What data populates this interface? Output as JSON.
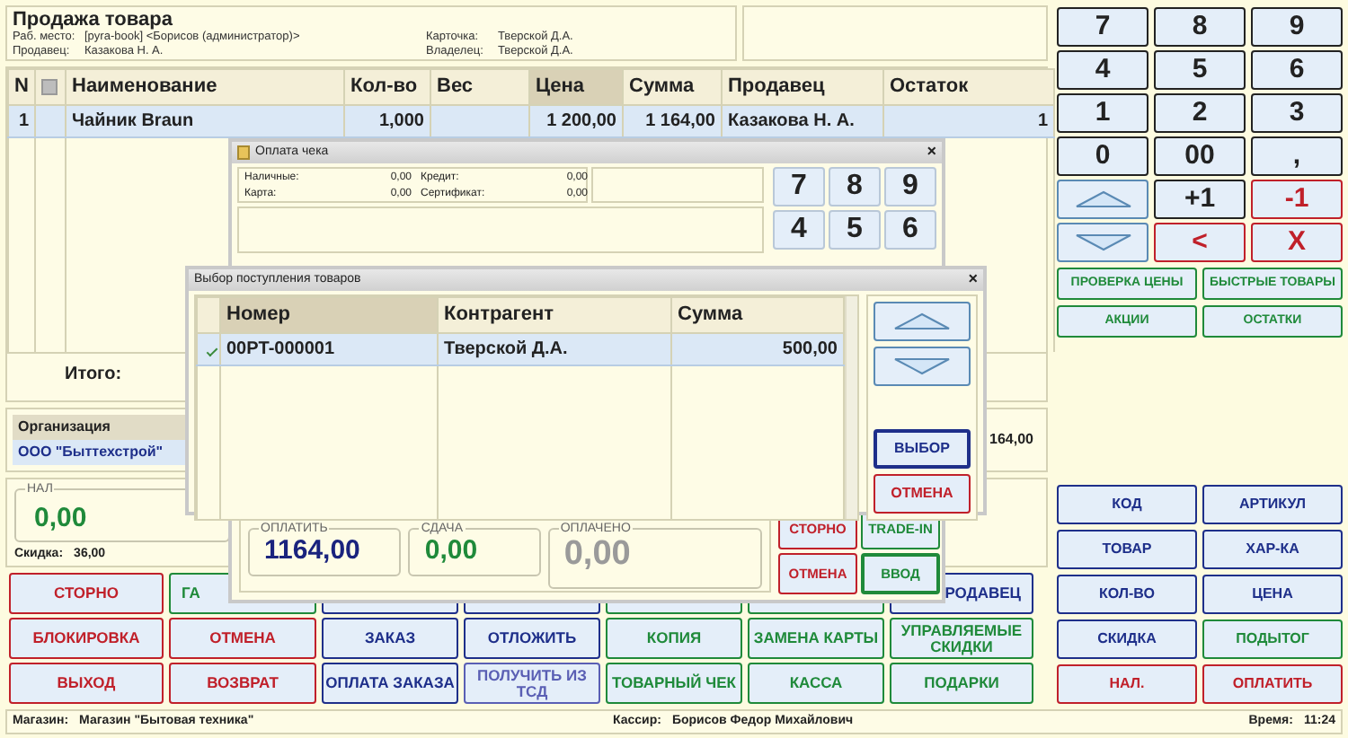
{
  "header": {
    "title": "Продажа товара",
    "fields": [
      {
        "label": "Раб. место:",
        "value": "[pyra-book] <Борисов (администратор)>"
      },
      {
        "label": "Карточка:",
        "value": "Тверской Д.А."
      },
      {
        "label": "Продавец:",
        "value": "Казакова Н. А."
      },
      {
        "label": "Владелец:",
        "value": "Тверской Д.А."
      }
    ]
  },
  "cart": {
    "columns": [
      {
        "label": "N",
        "sorted": false
      },
      {
        "label": "Наименование",
        "sorted": false
      },
      {
        "label": "Кол-во",
        "sorted": false
      },
      {
        "label": "Вес",
        "sorted": false
      },
      {
        "label": "Цена",
        "sorted": true
      },
      {
        "label": "Сумма",
        "sorted": false
      },
      {
        "label": "Продавец",
        "sorted": false
      },
      {
        "label": "Остаток",
        "sorted": false
      }
    ],
    "rows": [
      {
        "n": "1",
        "name": "Чайник Braun",
        "qty": "1,000",
        "price": "1 200,00",
        "sum": "1 164,00",
        "seller": "Казакова Н. А.",
        "stock": "1",
        "selected": true
      }
    ],
    "total_label": "Итого:"
  },
  "organization": {
    "header": "Организация",
    "value": "ООО \"Быттехстрой\"",
    "total": "164,00"
  },
  "cash": {
    "legend": "НАЛ",
    "value": "0,00"
  },
  "discount": {
    "label": "Скидка:",
    "value": "36,00"
  },
  "buttons": [
    [
      {
        "label": "СТОРНО",
        "color": "#c0202a"
      },
      {
        "label": "ГА",
        "color": "#1f8a3a"
      },
      {
        "color": "#1e2f8a"
      },
      {
        "color": "#1e2f8a"
      },
      {
        "color": "#1f8a3a"
      },
      {
        "color": "#1f8a3a"
      },
      {
        "label": "РОДАВЕЦ",
        "color": "#1e2f8a"
      }
    ],
    [
      {
        "label": "БЛОКИРОВКА",
        "color": "#c0202a"
      },
      {
        "label": "ОТМЕНА",
        "color": "#c0202a"
      },
      {
        "label": "ЗАКАЗ",
        "color": "#1e2f8a"
      },
      {
        "label": "ОТЛОЖИТЬ",
        "color": "#1e2f8a"
      },
      {
        "label": "КОПИЯ",
        "color": "#1f8a3a"
      },
      {
        "label": "ЗАМЕНА КАРТЫ",
        "color": "#1f8a3a"
      },
      {
        "label": "УПРАВЛЯЕМЫЕ СКИДКИ",
        "color": "#1f8a3a"
      }
    ],
    [
      {
        "label": "ВЫХОД",
        "color": "#c0202a"
      },
      {
        "label": "ВОЗВРАТ",
        "color": "#c0202a"
      },
      {
        "label": "ОПЛАТА ЗАКАЗА",
        "color": "#1e2f8a"
      },
      {
        "label": "ПОЛУЧИТЬ ИЗ ТСД",
        "color": "#5a5fb4"
      },
      {
        "label": "ТОВАРНЫЙ ЧЕК",
        "color": "#1f8a3a"
      },
      {
        "label": "КАССА",
        "color": "#1f8a3a"
      },
      {
        "label": "ПОДАРКИ",
        "color": "#1f8a3a"
      }
    ]
  ],
  "keypad": [
    {
      "kind": "text",
      "label": "7",
      "color": "#222222"
    },
    {
      "kind": "text",
      "label": "8",
      "color": "#222222"
    },
    {
      "kind": "text",
      "label": "9",
      "color": "#222222"
    },
    {
      "kind": "text",
      "label": "4",
      "color": "#222222"
    },
    {
      "kind": "text",
      "label": "5",
      "color": "#222222"
    },
    {
      "kind": "text",
      "label": "6",
      "color": "#222222"
    },
    {
      "kind": "text",
      "label": "1",
      "color": "#222222"
    },
    {
      "kind": "text",
      "label": "2",
      "color": "#222222"
    },
    {
      "kind": "text",
      "label": "3",
      "color": "#222222"
    },
    {
      "kind": "text",
      "label": "0",
      "color": "#222222"
    },
    {
      "kind": "text",
      "label": "00",
      "color": "#222222"
    },
    {
      "kind": "text",
      "label": ",",
      "color": "#222222"
    },
    {
      "kind": "up",
      "color": "#5a8ab4"
    },
    {
      "kind": "text",
      "label": "+1",
      "color": "#222222"
    },
    {
      "kind": "text",
      "label": "-1",
      "color": "#c0202a"
    },
    {
      "kind": "down",
      "color": "#5a8ab4"
    },
    {
      "kind": "text",
      "label": "<",
      "color": "#c0202a"
    },
    {
      "kind": "text",
      "label": "X",
      "color": "#c0202a"
    }
  ],
  "quick_buttons": [
    {
      "label": "ПРОВЕРКА ЦЕНЫ",
      "color": "#1f8a3a"
    },
    {
      "label": "БЫСТРЫЕ ТОВАРЫ",
      "color": "#1f8a3a"
    },
    {
      "label": "АКЦИИ",
      "color": "#1f8a3a"
    },
    {
      "label": "ОСТАТКИ",
      "color": "#1f8a3a"
    }
  ],
  "function_buttons": [
    {
      "label": "КОД",
      "color": "#1e2f8a"
    },
    {
      "label": "АРТИКУЛ",
      "color": "#1e2f8a"
    },
    {
      "label": "ТОВАР",
      "color": "#1e2f8a"
    },
    {
      "label": "ХАР-КА",
      "color": "#1e2f8a"
    },
    {
      "label": "КОЛ-ВО",
      "color": "#1e2f8a"
    },
    {
      "label": "ЦЕНА",
      "color": "#1e2f8a"
    },
    {
      "label": "СКИДКА",
      "color": "#1e2f8a"
    },
    {
      "label": "ПОДЫТОГ",
      "color": "#1f8a3a"
    },
    {
      "label": "НАЛ.",
      "color": "#c0202a"
    },
    {
      "label": "ОПЛАТИТЬ",
      "color": "#c0202a"
    }
  ],
  "status_bar": {
    "store_label": "Магазин:",
    "store": "Магазин \"Бытовая техника\"",
    "cashier_label": "Кассир:",
    "cashier": "Борисов Федор Михайлович",
    "time_label": "Время:",
    "time": "11:24"
  },
  "payment_dialog": {
    "title": "Оплата чека",
    "close": "×",
    "fields": [
      {
        "label": "Наличные:",
        "value": "0,00"
      },
      {
        "label": "Кредит:",
        "value": "0,00"
      },
      {
        "label": "Карта:",
        "value": "0,00"
      },
      {
        "label": "Сертификат:",
        "value": "0,00"
      }
    ],
    "keypad": [
      "7",
      "8",
      "9",
      "4",
      "5",
      "6"
    ],
    "amounts": [
      {
        "legend": "ОПЛАТИТЬ",
        "value": "1164,00",
        "color": "#1a237e"
      },
      {
        "legend": "СДАЧА",
        "value": "0,00",
        "color": "#1f8a3a"
      },
      {
        "legend": "ОПЛАЧЕНО",
        "value": "0,00",
        "color": "#9a9a9a"
      }
    ],
    "buttons": [
      {
        "label": "СТОРНО",
        "color": "#c0202a",
        "default": false
      },
      {
        "label": "TRADE-IN",
        "color": "#1f8a3a",
        "default": false
      },
      {
        "label": "ОТМЕНА",
        "color": "#c0202a",
        "default": false
      },
      {
        "label": "ВВОД",
        "color": "#1f8a3a",
        "default": true
      }
    ]
  },
  "receipt_dialog": {
    "title": "Выбор поступления товаров",
    "close": "×",
    "columns": [
      "Номер",
      "Контрагент",
      "Сумма"
    ],
    "rows": [
      {
        "number": "00PT-000001",
        "contractor": "Тверской Д.А.",
        "sum": "500,00",
        "checked": true,
        "selected": true
      }
    ],
    "buttons": [
      {
        "kind": "up",
        "color": "#5a8ab4",
        "default": false
      },
      {
        "kind": "down",
        "color": "#5a8ab4",
        "default": false
      },
      {
        "kind": "text",
        "label": "ВЫБОР",
        "color": "#1e2f8a",
        "default": true
      },
      {
        "kind": "text",
        "label": "ОТМЕНА",
        "color": "#c0202a",
        "default": false
      }
    ]
  }
}
